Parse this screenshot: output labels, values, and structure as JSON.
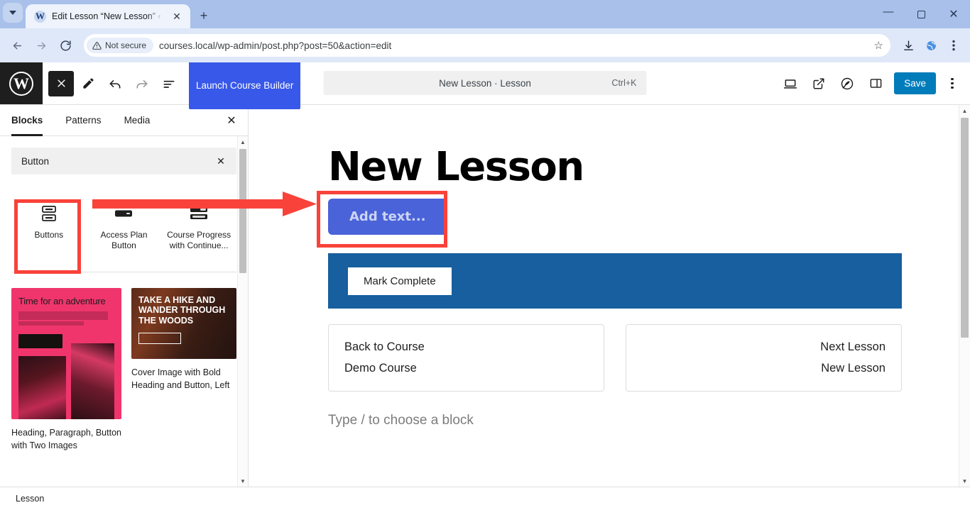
{
  "browser": {
    "tab": {
      "title": "Edit Lesson “New Lesson” ‹ cou",
      "favicon_glyph": "W",
      "close_glyph": "✕"
    },
    "new_tab_glyph": "+",
    "window_controls": {
      "minimize": "—",
      "maximize": "❐",
      "close": "✕"
    },
    "nav": {
      "back": "←",
      "forward": "→",
      "reload": "⟳"
    },
    "omnibox": {
      "security_label": "Not secure",
      "url": "courses.local/wp-admin/post.php?post=50&action=edit",
      "star_glyph": "☆"
    },
    "toolbar_icons": [
      "download-icon",
      "extension-icon",
      "browser-menu-icon"
    ]
  },
  "editor_header": {
    "logo_letter": "W",
    "close_inserter_glyph": "✕",
    "tools": [
      "edit-pencil-icon",
      "undo-icon",
      "redo-icon",
      "document-overview-icon"
    ],
    "launch_button": "Launch Course Builder",
    "command_bar": {
      "title": "New Lesson · Lesson",
      "shortcut": "Ctrl+K"
    },
    "right_icons": [
      "view-desktop-icon",
      "preview-external-icon",
      "jetpack-icon",
      "settings-sidebar-icon"
    ],
    "save_label": "Save",
    "menu_glyph": "kebab-menu-icon"
  },
  "inserter": {
    "tabs": [
      {
        "label": "Blocks",
        "active": true
      },
      {
        "label": "Patterns",
        "active": false
      },
      {
        "label": "Media",
        "active": false
      }
    ],
    "close_glyph": "✕",
    "search": {
      "value": "Button",
      "clear_glyph": "✕"
    },
    "blocks": [
      {
        "label": "Buttons",
        "icon": "buttons-block-icon",
        "highlighted": true
      },
      {
        "label": "Access Plan Button",
        "icon": "access-plan-button-icon",
        "highlighted": false
      },
      {
        "label": "Course Progress with Continue...",
        "icon": "course-progress-icon",
        "highlighted": false
      }
    ],
    "patterns": [
      {
        "caption": "Heading, Paragraph, Button with Two Images",
        "preview_heading": "Time for an adventure"
      },
      {
        "caption": "Cover Image with Bold Heading and Button, Left",
        "preview_heading": "TAKE A HIKE AND WANDER THROUGH THE WOODS"
      }
    ]
  },
  "canvas": {
    "post_title": "New Lesson",
    "add_text_placeholder": "Add text...",
    "mark_complete_label": "Mark Complete",
    "nav_left": {
      "line1": "Back to Course",
      "line2": "Demo Course"
    },
    "nav_right": {
      "line1": "Next Lesson",
      "line2": "New Lesson"
    },
    "block_placeholder": "Type / to choose a block"
  },
  "footer": {
    "breadcrumb": "Lesson"
  },
  "colors": {
    "accent_blue": "#3858e9",
    "save_blue": "#007cba",
    "button_blue": "#4a63d8",
    "mark_bar_blue": "#175f9e",
    "annotation_red": "#f9423a"
  }
}
